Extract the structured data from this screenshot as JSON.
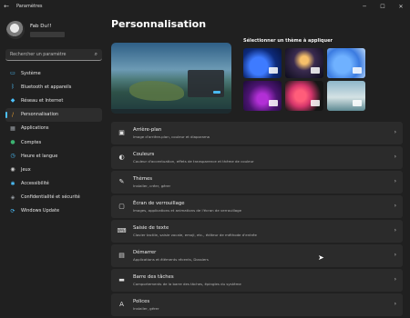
{
  "window": {
    "title": "Paramètres",
    "back_icon": "arrow-left-icon",
    "controls": [
      "minimize-icon",
      "maximize-icon",
      "close-icon"
    ]
  },
  "user": {
    "name": "Fab Du!!"
  },
  "search": {
    "placeholder": "Rechercher un paramètre",
    "icon": "search-icon"
  },
  "sidebar": {
    "items": [
      {
        "label": "Système",
        "icon": "monitor-icon",
        "color": "#4cc2ff",
        "active": false
      },
      {
        "label": "Bluetooth et appareils",
        "icon": "bluetooth-icon",
        "color": "#4cc2ff",
        "active": false
      },
      {
        "label": "Réseau et Internet",
        "icon": "wifi-icon",
        "color": "#4cc2ff",
        "active": false
      },
      {
        "label": "Personnalisation",
        "icon": "paintbrush-icon",
        "color": "#f0a030",
        "active": true
      },
      {
        "label": "Applications",
        "icon": "apps-icon",
        "color": "#9aa0a6",
        "active": false
      },
      {
        "label": "Comptes",
        "icon": "person-icon",
        "color": "#3cb371",
        "active": false
      },
      {
        "label": "Heure et langue",
        "icon": "globe-clock-icon",
        "color": "#4cc2ff",
        "active": false
      },
      {
        "label": "Jeux",
        "icon": "gamepad-icon",
        "color": "#cfcfcf",
        "active": false
      },
      {
        "label": "Accessibilité",
        "icon": "accessibility-icon",
        "color": "#4cc2ff",
        "active": false
      },
      {
        "label": "Confidentialité et sécurité",
        "icon": "shield-icon",
        "color": "#9aa0a6",
        "active": false
      },
      {
        "label": "Windows Update",
        "icon": "sync-icon",
        "color": "#4cc2ff",
        "active": false
      }
    ]
  },
  "main": {
    "title": "Personnalisation",
    "theme_section_label": "Sélectionner un thème à appliquer",
    "settings": [
      {
        "title": "Arrière-plan",
        "subtitle": "Image d'arrière-plan, couleur et diaporama",
        "icon": "image-icon"
      },
      {
        "title": "Couleurs",
        "subtitle": "Couleur d'accentuation, effets de transparence et thème de couleur",
        "icon": "palette-icon"
      },
      {
        "title": "Thèmes",
        "subtitle": "Installer, créer, gérer",
        "icon": "brush-icon"
      },
      {
        "title": "Écran de verrouillage",
        "subtitle": "Images, applications et animations de l'écran de verrouillage",
        "icon": "lock-screen-icon"
      },
      {
        "title": "Saisie de texte",
        "subtitle": "Clavier tactile, saisie vocale, emoji, etc., éditeur de méthode d'entrée",
        "icon": "keyboard-icon"
      },
      {
        "title": "Démarrer",
        "subtitle": "Applications et éléments récents, Dossiers",
        "icon": "start-menu-icon"
      },
      {
        "title": "Barre des tâches",
        "subtitle": "Comportements de la barre des tâches, épingles du système",
        "icon": "taskbar-icon"
      },
      {
        "title": "Polices",
        "subtitle": "Installer, gérer",
        "icon": "fonts-icon"
      }
    ]
  },
  "accent_color": "#4cc2ff"
}
